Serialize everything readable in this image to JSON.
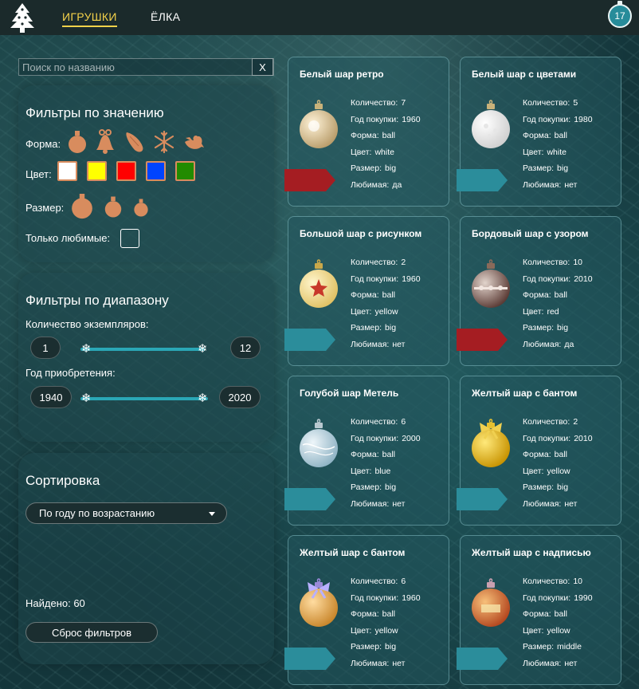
{
  "header": {
    "nav": [
      "ИГРУШКИ",
      "ЁЛКА"
    ],
    "favorites_count": "17"
  },
  "search": {
    "placeholder": "Поиск по названию",
    "clear": "X"
  },
  "value_filters": {
    "title": "Фильтры по значению",
    "shape_label": "Форма:",
    "shapes": [
      "ball-icon",
      "bell-icon",
      "cone-icon",
      "snowflake-icon",
      "bird-icon"
    ],
    "color_label": "Цвет:",
    "colors": [
      "#ffffff",
      "#ffff00",
      "#ff0000",
      "#0044ff",
      "#228b00"
    ],
    "size_label": "Размер:",
    "favorite_label": "Только любимые:"
  },
  "range_filters": {
    "title": "Фильтры по диапазону",
    "count_label": "Количество экземпляров:",
    "count_min": "1",
    "count_max": "12",
    "year_label": "Год приобретения:",
    "year_min": "1940",
    "year_max": "2020"
  },
  "sort": {
    "title": "Сортировка",
    "selected": "По году по возрастанию",
    "found_label": "Найдено: 60",
    "reset": "Сброс фильтров"
  },
  "field_labels": {
    "count": "Количество:",
    "year": "Год покупки:",
    "shape": "Форма:",
    "color": "Цвет:",
    "size": "Размер:",
    "favorite": "Любимая:"
  },
  "accent": {
    "favorite_ribbon": "#a51d22",
    "ribbon": "#2b8d9b",
    "brand": "#f5d24a"
  },
  "cards": [
    {
      "title": "Белый шар ретро",
      "count": "7",
      "year": "1960",
      "shape": "ball",
      "color": "white",
      "size": "big",
      "favorite": "да",
      "is_favorite": true
    },
    {
      "title": "Белый шар с цветами",
      "count": "5",
      "year": "1980",
      "shape": "ball",
      "color": "white",
      "size": "big",
      "favorite": "нет",
      "is_favorite": false
    },
    {
      "title": "Большой шар с рисунком",
      "count": "2",
      "year": "1960",
      "shape": "ball",
      "color": "yellow",
      "size": "big",
      "favorite": "нет",
      "is_favorite": false
    },
    {
      "title": "Бордовый шар с узором",
      "count": "10",
      "year": "2010",
      "shape": "ball",
      "color": "red",
      "size": "big",
      "favorite": "да",
      "is_favorite": true
    },
    {
      "title": "Голубой шар Метель",
      "count": "6",
      "year": "2000",
      "shape": "ball",
      "color": "blue",
      "size": "big",
      "favorite": "нет",
      "is_favorite": false
    },
    {
      "title": "Желтый шар с бантом",
      "count": "2",
      "year": "2010",
      "shape": "ball",
      "color": "yellow",
      "size": "big",
      "favorite": "нет",
      "is_favorite": false
    },
    {
      "title": "Желтый шар с бантом",
      "count": "6",
      "year": "1960",
      "shape": "ball",
      "color": "yellow",
      "size": "big",
      "favorite": "нет",
      "is_favorite": false
    },
    {
      "title": "Желтый шар с надписью",
      "count": "10",
      "year": "1990",
      "shape": "ball",
      "color": "yellow",
      "size": "middle",
      "favorite": "нет",
      "is_favorite": false
    }
  ]
}
